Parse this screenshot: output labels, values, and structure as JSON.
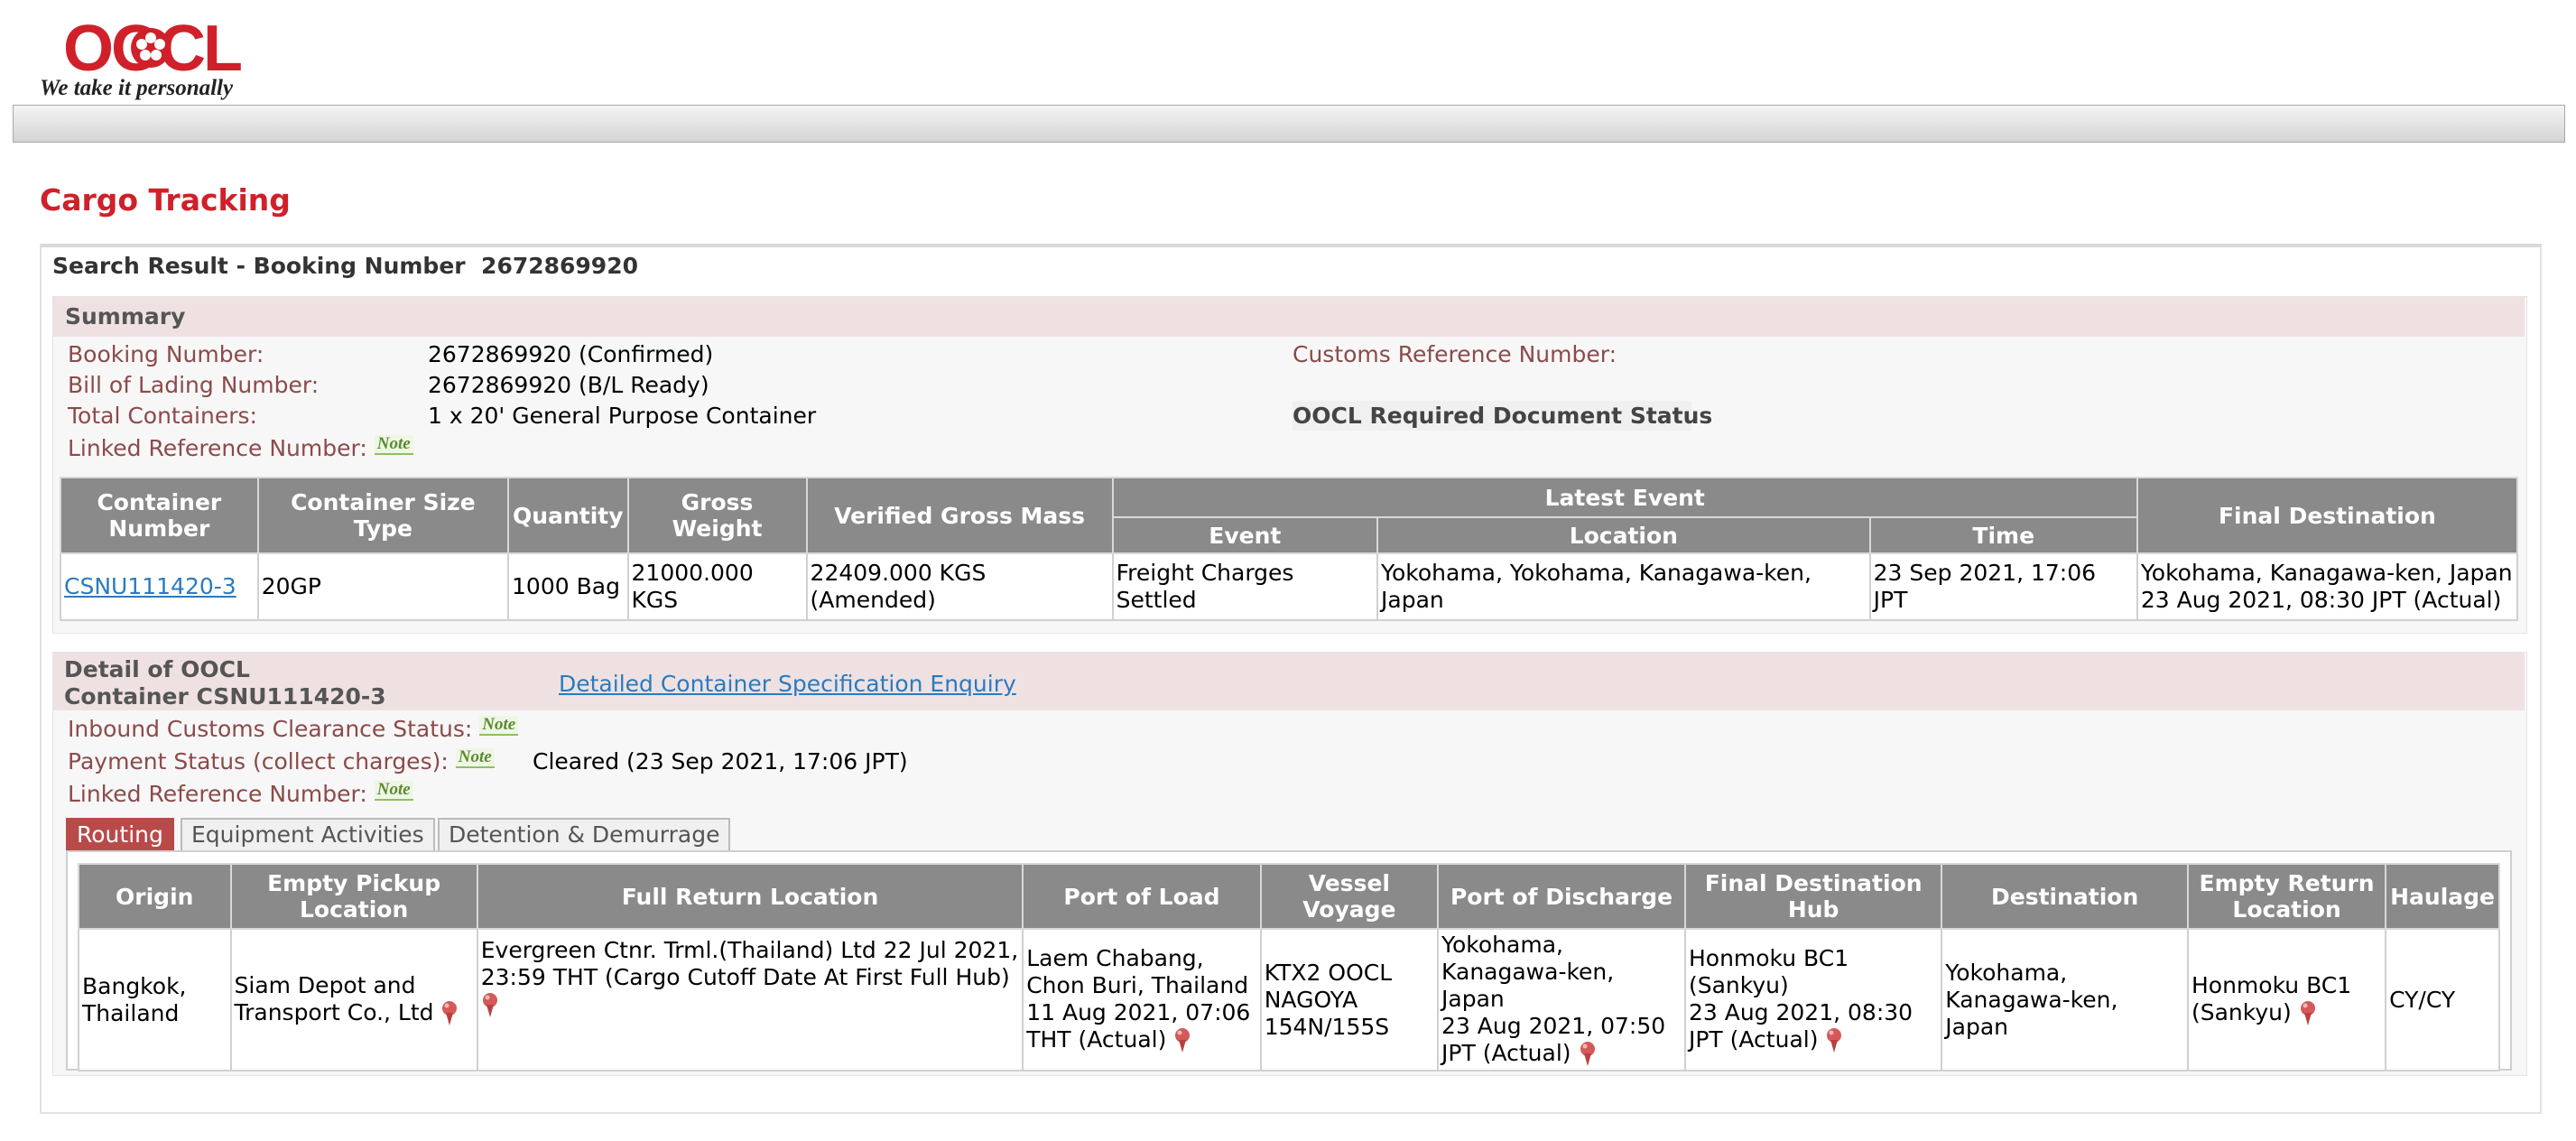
{
  "header": {
    "logo_text": "OOCL",
    "tagline": "We take it personally"
  },
  "page_title": "Cargo Tracking",
  "search_result": {
    "heading_prefix": "Search Result - Booking Number",
    "booking_number": "2672869920"
  },
  "summary": {
    "title": "Summary",
    "booking_number_label": "Booking Number:",
    "booking_number_value": "2672869920 (Confirmed)",
    "bl_label": "Bill of Lading Number:",
    "bl_value": "2672869920 (B/L Ready)",
    "total_containers_label": "Total Containers:",
    "total_containers_value": "1 x 20' General Purpose Container",
    "linked_ref_label": "Linked Reference Number:",
    "customs_ref_label": "Customs Reference Number:",
    "doc_status_heading": "OOCL Required Document Status",
    "note_label": "Note"
  },
  "container_table": {
    "headers": {
      "container_number": "Container Number",
      "size_type": "Container Size Type",
      "quantity": "Quantity",
      "gross_weight": "Gross Weight",
      "vgm": "Verified Gross Mass",
      "latest_event": "Latest Event",
      "event": "Event",
      "location": "Location",
      "time": "Time",
      "final_destination": "Final Destination"
    },
    "row": {
      "container_number": "CSNU111420-3",
      "size_type": "20GP",
      "quantity": "1000 Bag",
      "gross_weight": "21000.000 KGS",
      "vgm": "22409.000 KGS (Amended)",
      "event": "Freight Charges Settled",
      "location": "Yokohama, Yokohama, Kanagawa-ken, Japan",
      "time": "23 Sep 2021, 17:06 JPT",
      "final_destination_place": "Yokohama, Kanagawa-ken, Japan",
      "final_destination_time": "23 Aug 2021, 08:30 JPT (Actual)"
    }
  },
  "detail": {
    "title_line1": "Detail of OOCL",
    "title_line2": "Container CSNU111420-3",
    "spec_link": "Detailed Container Specification Enquiry",
    "inbound_customs_label": "Inbound Customs Clearance Status:",
    "payment_status_label": "Payment Status (collect charges):",
    "payment_status_value": "Cleared (23 Sep 2021, 17:06 JPT)",
    "linked_ref_label": "Linked Reference Number:",
    "note_label": "Note"
  },
  "tabs": [
    "Routing",
    "Equipment Activities",
    "Detention & Demurrage"
  ],
  "routing_table": {
    "headers": {
      "origin": "Origin",
      "empty_pickup": "Empty Pickup Location",
      "full_return": "Full Return Location",
      "port_of_load": "Port of Load",
      "vessel_voyage": "Vessel Voyage",
      "port_of_discharge": "Port of Discharge",
      "final_destination_hub": "Final Destination Hub",
      "destination": "Destination",
      "empty_return": "Empty Return Location",
      "haulage": "Haulage"
    },
    "row": {
      "origin": "Bangkok, Thailand",
      "empty_pickup": "Siam Depot and Transport Co., Ltd",
      "full_return": "Evergreen Ctnr. Trml.(Thailand) Ltd  22 Jul 2021, 23:59 THT (Cargo Cutoff Date At First Full Hub)",
      "port_of_load_place": "Laem Chabang, Chon Buri, Thailand",
      "port_of_load_time": "11 Aug 2021, 07:06 THT (Actual)",
      "vessel_voyage": "KTX2 OOCL NAGOYA 154N/155S",
      "port_of_discharge_place": "Yokohama, Kanagawa-ken, Japan",
      "port_of_discharge_time": "23 Aug 2021, 07:50 JPT (Actual)",
      "final_hub_place": "Honmoku BC1 (Sankyu)",
      "final_hub_time": "23 Aug 2021, 08:30 JPT (Actual)",
      "destination": "Yokohama, Kanagawa-ken, Japan",
      "empty_return": "Honmoku BC1 (Sankyu)",
      "haulage": "CY/CY"
    }
  },
  "colors": {
    "brand_red": "#d0202a",
    "label_brown": "#8c4a4a",
    "header_grey": "#8a8a8a",
    "link_blue": "#2a7bbf",
    "panel_pink": "#efe1e2"
  }
}
